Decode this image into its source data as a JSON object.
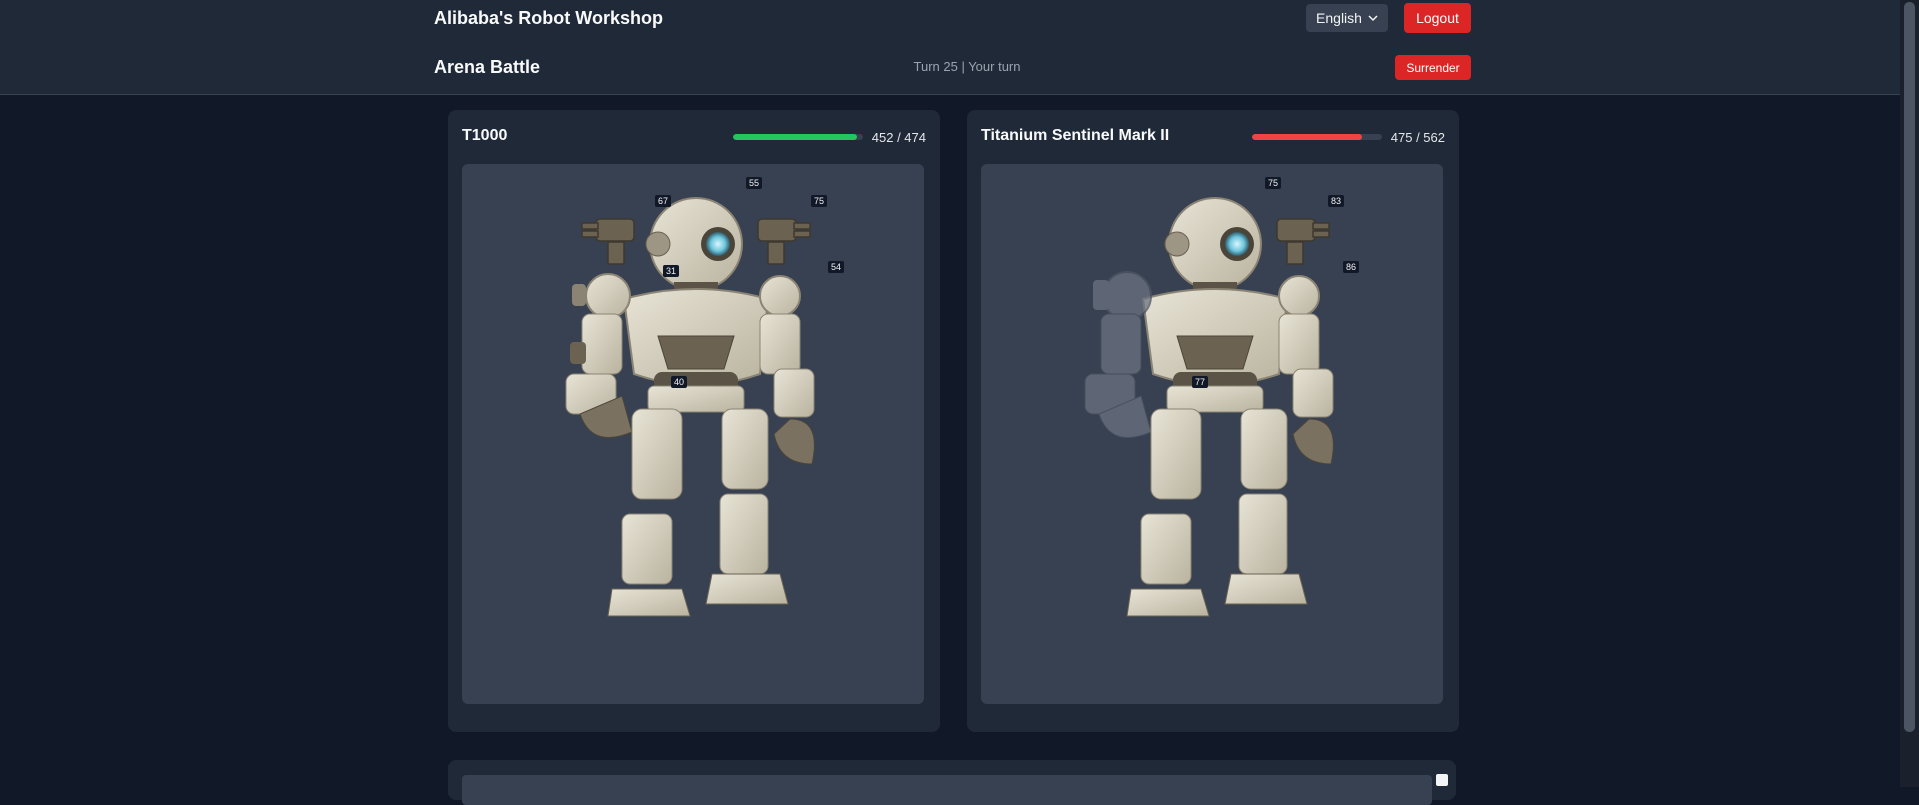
{
  "header": {
    "app_title": "Alibaba's Robot Workshop",
    "language": "English",
    "logout_label": "Logout"
  },
  "battle": {
    "title": "Arena Battle",
    "turn_info": "Turn 25 | Your turn",
    "surrender_label": "Surrender"
  },
  "robots": [
    {
      "name": "T1000",
      "hp_text": "452 / 474",
      "hp_current": 452,
      "hp_max": 474,
      "hp_color": "#22c55e",
      "part_values": [
        "55",
        "67",
        "75",
        "31",
        "54",
        "40"
      ]
    },
    {
      "name": "Titanium Sentinel Mark II",
      "hp_text": "475 / 562",
      "hp_current": 475,
      "hp_max": 562,
      "hp_color": "#ef4444",
      "part_values": [
        "75",
        "83",
        "86",
        "77"
      ]
    }
  ],
  "colors": {
    "accent_danger": "#dc2626",
    "background": "#111827",
    "panel": "#1f2937"
  }
}
